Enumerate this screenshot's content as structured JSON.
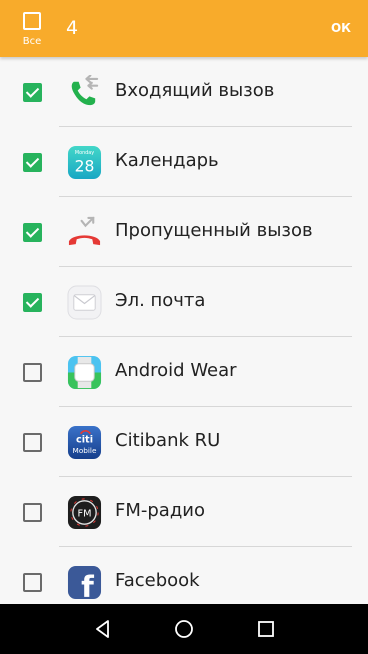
{
  "header": {
    "select_all_label": "Все",
    "selected_count": "4",
    "ok_label": "ОК"
  },
  "apps": [
    {
      "label": "Входящий вызов",
      "checked": true,
      "icon": "incoming-call-icon"
    },
    {
      "label": "Календарь",
      "checked": true,
      "icon": "calendar-icon",
      "icon_text": "28",
      "icon_small_text": "Monday"
    },
    {
      "label": "Пропущенный вызов",
      "checked": true,
      "icon": "missed-call-icon"
    },
    {
      "label": "Эл. почта",
      "checked": true,
      "icon": "email-icon"
    },
    {
      "label": "Android Wear",
      "checked": false,
      "icon": "android-wear-icon"
    },
    {
      "label": "Citibank RU",
      "checked": false,
      "icon": "citibank-icon",
      "icon_text": "citi",
      "icon_small_text": "Mobile"
    },
    {
      "label": "FM-радио",
      "checked": false,
      "icon": "fm-radio-icon",
      "icon_text": "FM"
    },
    {
      "label": "Facebook",
      "checked": false,
      "icon": "facebook-icon",
      "icon_text": "f"
    }
  ],
  "navbar": {
    "icons": [
      "back-icon",
      "home-icon",
      "recents-icon"
    ]
  },
  "colors": {
    "accent": "#f8ab2b",
    "checkbox_checked": "#27b35d"
  }
}
